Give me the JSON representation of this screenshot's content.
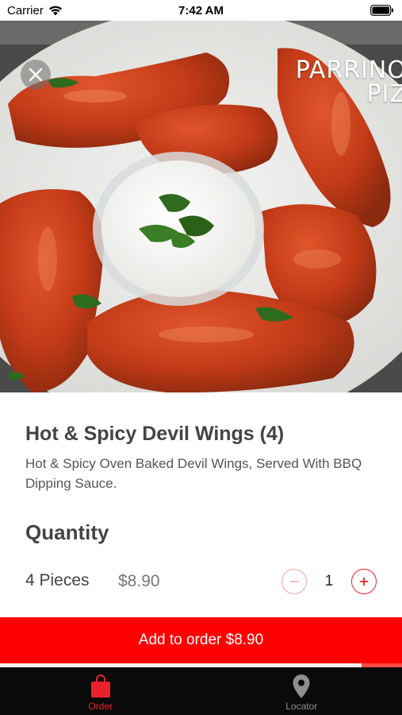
{
  "status_bar": {
    "carrier": "Carrier",
    "time": "7:42 AM"
  },
  "hero": {
    "brand_line1": "PARRINO",
    "brand_line2": "PIZ"
  },
  "item": {
    "title": "Hot & Spicy Devil Wings (4)",
    "description": "Hot & Spicy Oven Baked Devil Wings, Served With BBQ Dipping Sauce."
  },
  "quantity": {
    "heading": "Quantity",
    "option_name": "4 Pieces",
    "option_price": "$8.90",
    "minus_symbol": "−",
    "plus_symbol": "+",
    "value": "1"
  },
  "add_to_order": {
    "label": "Add to order $8.90",
    "progress_fraction": 0.9
  },
  "tabs": [
    {
      "label": "Order",
      "icon": "shopping-bag-icon",
      "active": true
    },
    {
      "label": "Locator",
      "icon": "map-pin-icon",
      "active": false
    }
  ],
  "colors": {
    "accent": "#e8212a",
    "button": "#ff0000",
    "tab_bar": "#0a0a0a"
  }
}
